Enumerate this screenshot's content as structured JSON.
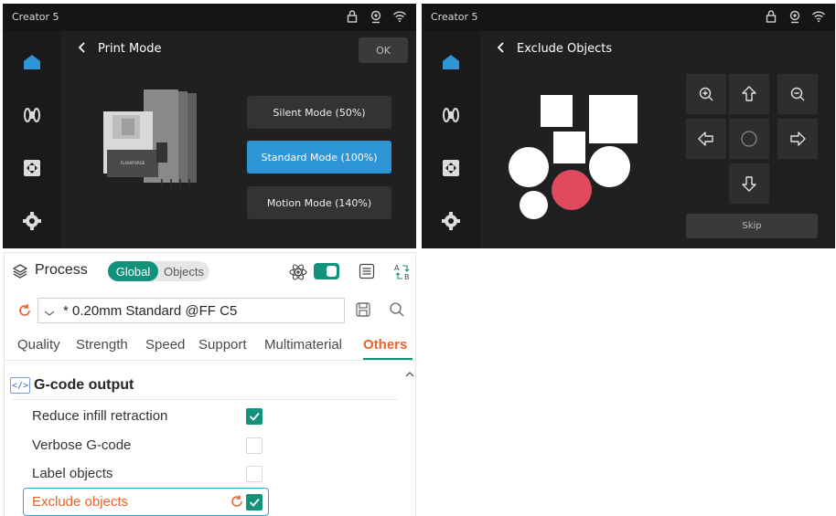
{
  "print_mode_screen": {
    "status_title": "Creator 5",
    "status_icons": [
      "lock-icon",
      "camera-icon",
      "wifi-icon"
    ],
    "sidebar_icons": [
      "home-icon",
      "spool-icon",
      "calibrate-icon",
      "settings-icon"
    ],
    "title": "Print Mode",
    "ok_label": "OK",
    "modes": [
      {
        "label": "Silent Mode (50%)",
        "selected": false
      },
      {
        "label": "Standard Mode (100%)",
        "selected": true
      },
      {
        "label": "Motion Mode (140%)",
        "selected": false
      }
    ],
    "printer_logo": "FLASHFORGE"
  },
  "exclude_screen": {
    "status_title": "Creator 5",
    "status_icons": [
      "lock-icon",
      "camera-icon",
      "wifi-icon"
    ],
    "sidebar_icons": [
      "home-icon",
      "spool-icon",
      "calibrate-icon",
      "settings-icon"
    ],
    "title": "Exclude Objects",
    "controls": [
      "zoom-in-icon",
      "arrow-up-icon",
      "zoom-out-icon",
      "arrow-left-icon",
      "center-icon",
      "arrow-right-icon",
      "arrow-down-icon"
    ],
    "skip_label": "Skip",
    "excluded_color": "#e04a5e"
  },
  "process_panel": {
    "title": "Process",
    "toggle_global": "Global",
    "toggle_objects": "Objects",
    "preset": "* 0.20mm Standard @FF C5",
    "tabs": [
      "Quality",
      "Strength",
      "Speed",
      "Support",
      "Multimaterial",
      "Others"
    ],
    "active_tab": "Others",
    "group_icon_text": "</>",
    "group_title": "G-code output",
    "options": [
      {
        "label": "Reduce infill retraction",
        "checked": true
      },
      {
        "label": "Verbose G-code",
        "checked": false
      },
      {
        "label": "Label objects",
        "checked": false
      },
      {
        "label": "Exclude objects",
        "checked": true
      }
    ],
    "accent_color": "#12927b",
    "changed_color": "#e8622a"
  }
}
